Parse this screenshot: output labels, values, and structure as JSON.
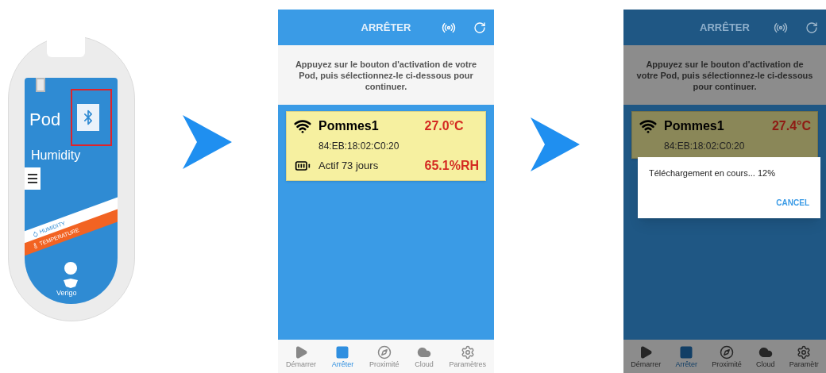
{
  "device": {
    "name": "Pod",
    "subtitle": "Humidity",
    "bands": [
      {
        "label": "HUMIDITY",
        "kind": "humidity"
      },
      {
        "label": "TEMPERATURE",
        "kind": "temperature"
      }
    ],
    "brand": "Verigo"
  },
  "screens": [
    {
      "dimmed": false,
      "title": "ARRÊTER",
      "instruction": "Appuyez sur le bouton d'activation de votre Pod, puis sélectionnez-le ci-dessous pour continuer.",
      "pod": {
        "name": "Pommes1",
        "temperature": "27.0°C",
        "address": "84:EB:18:02:C0:20",
        "status": "Actif 73 jours",
        "humidity": "65.1%RH"
      },
      "tabs": [
        {
          "label": "Démarrer",
          "kind": "start",
          "selected": false
        },
        {
          "label": "Arrêter",
          "kind": "stop",
          "selected": true
        },
        {
          "label": "Proximité",
          "kind": "proximity",
          "selected": false
        },
        {
          "label": "Cloud",
          "kind": "cloud",
          "selected": false
        },
        {
          "label": "Paramètres",
          "kind": "settings",
          "selected": false
        }
      ]
    },
    {
      "dimmed": true,
      "title": "ARRÊTER",
      "instruction": "Appuyez sur le bouton d'activation de votre Pod, puis sélectionnez-le ci-dessous pour continuer.",
      "pod": {
        "name": "Pommes1",
        "temperature": "27.4°C",
        "address": "84:EB:18:02:C0:20"
      },
      "dialog": {
        "message": "Téléchargement en cours... 12%",
        "button": "CANCEL"
      },
      "tabs": [
        {
          "label": "Démarrer",
          "kind": "start",
          "selected": false
        },
        {
          "label": "Arrêter",
          "kind": "stop",
          "selected": true
        },
        {
          "label": "Proximité",
          "kind": "proximity",
          "selected": false
        },
        {
          "label": "Cloud",
          "kind": "cloud",
          "selected": false
        },
        {
          "label": "Paramètr",
          "kind": "settings",
          "selected": false
        }
      ]
    }
  ]
}
